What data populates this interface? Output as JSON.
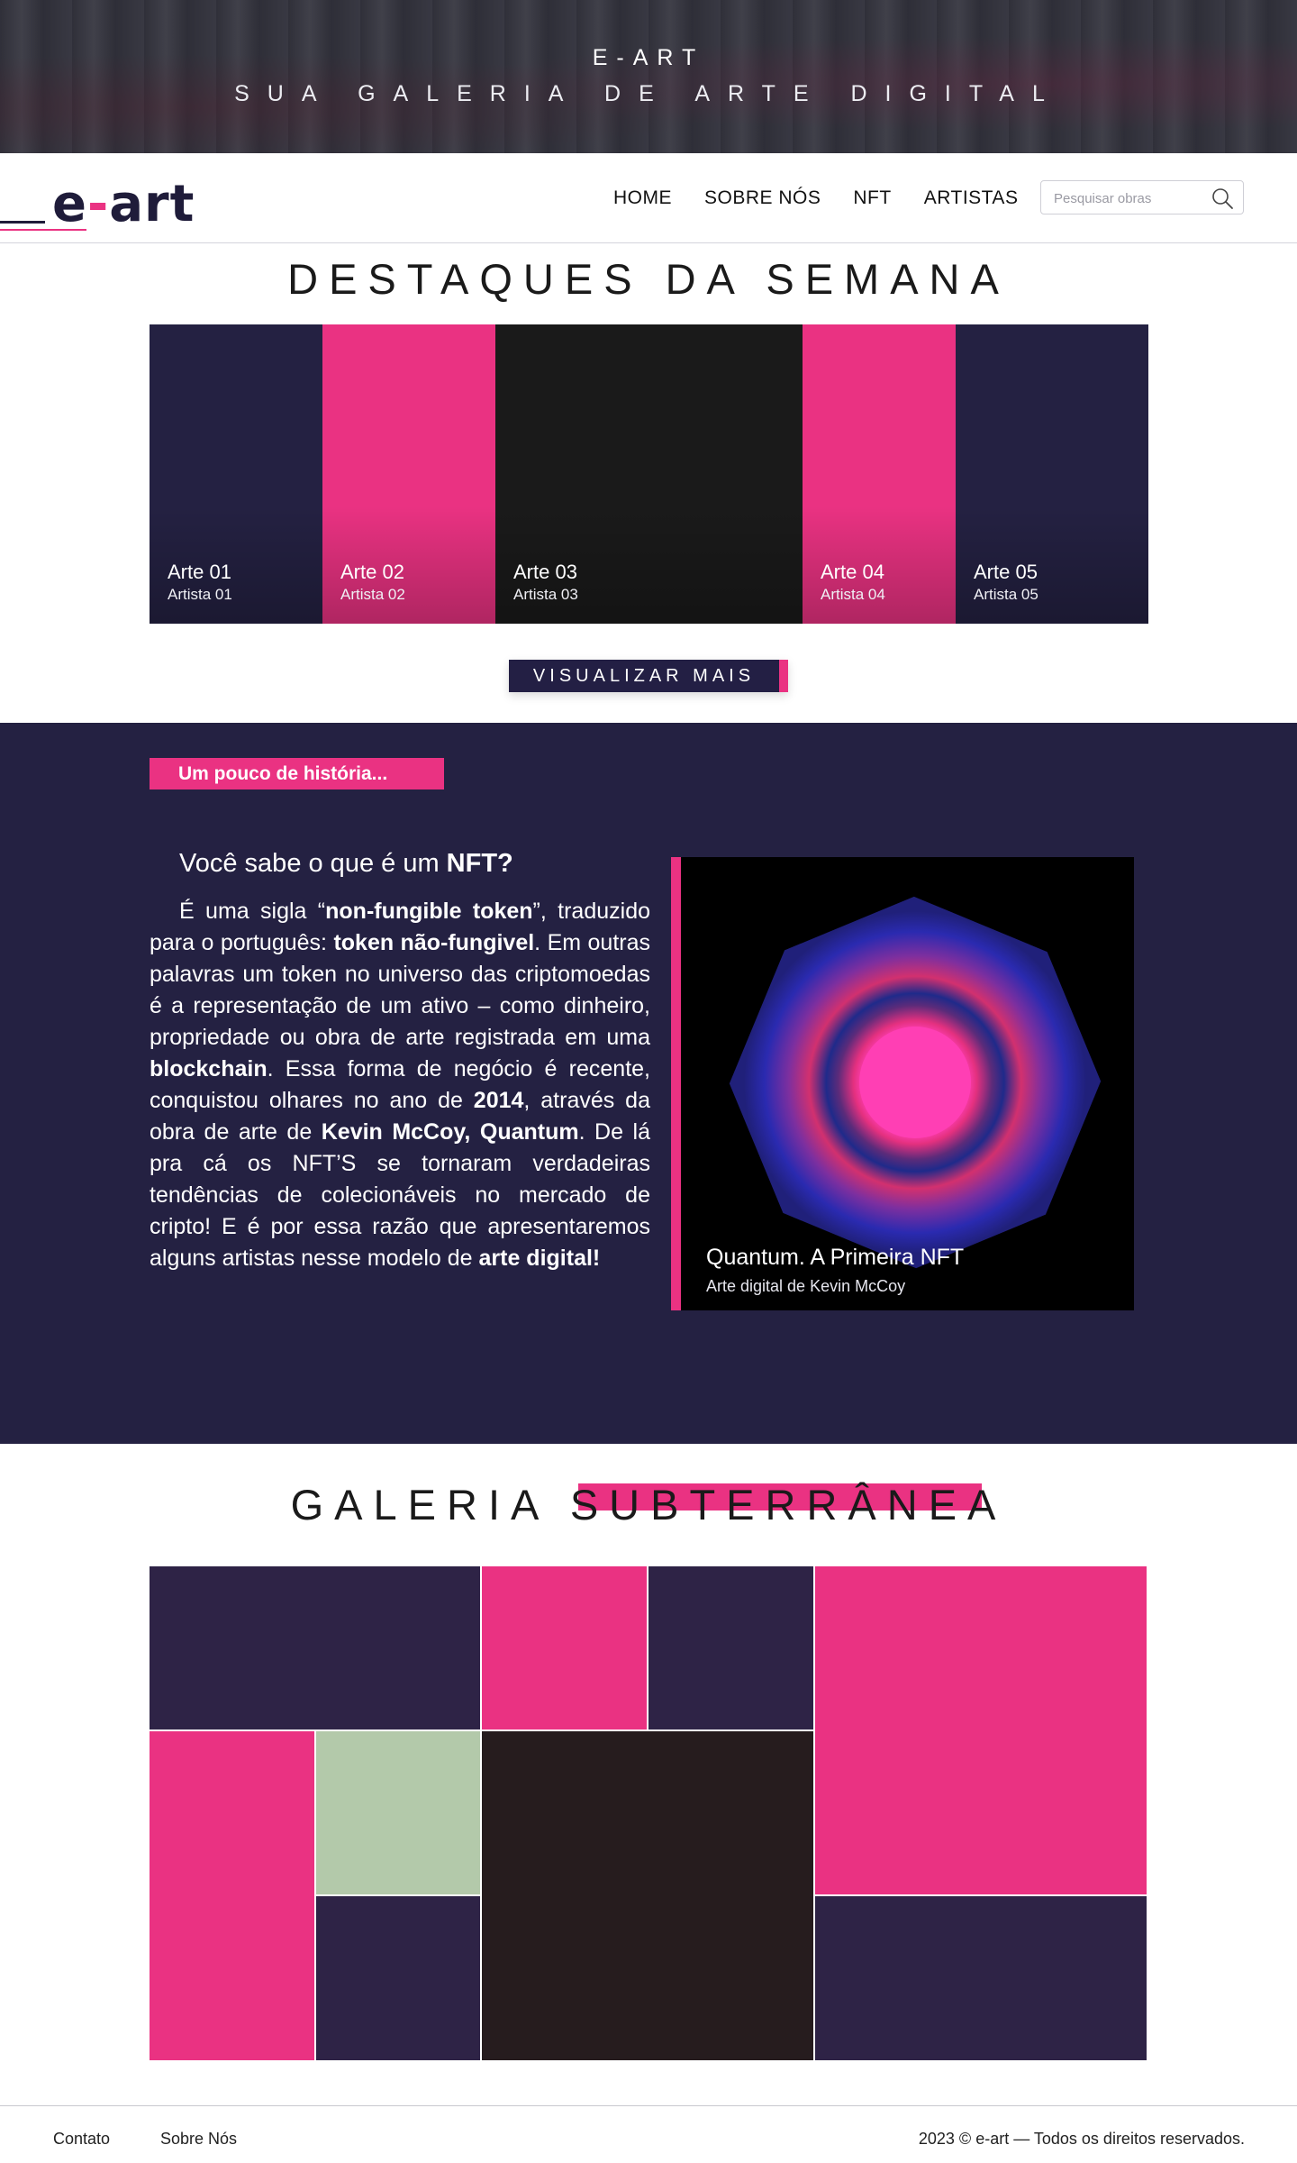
{
  "hero": {
    "title": "E-ART",
    "subtitle": "SUA GALERIA DE ARTE DIGITAL"
  },
  "nav": {
    "logo_text": "e-art",
    "items": [
      "HOME",
      "SOBRE NÓS",
      "NFT",
      "ARTISTAS"
    ],
    "search_placeholder": "Pesquisar obras",
    "search_icon": "search-icon"
  },
  "destaques": {
    "title": "DESTAQUES DA SEMANA",
    "cards": [
      {
        "title": "Arte 01",
        "artist": "Artista 01",
        "color": "#242142"
      },
      {
        "title": "Arte 02",
        "artist": "Artista 02",
        "color": "#ea3282"
      },
      {
        "title": "Arte 03",
        "artist": "Artista 03",
        "color": "#1a1a1a"
      },
      {
        "title": "Arte 04",
        "artist": "Artista 04",
        "color": "#ea3282"
      },
      {
        "title": "Arte 05",
        "artist": "Artista 05",
        "color": "#242142"
      }
    ],
    "view_more": "VISUALIZAR MAIS"
  },
  "historia": {
    "tag": "Um pouco de história...",
    "question_prefix": "Você sabe o que é um ",
    "question_bold": "NFT?",
    "paragraph": [
      {
        "t": "É uma sigla “",
        "b": false
      },
      {
        "t": "non-fungible token",
        "b": true
      },
      {
        "t": "”, traduzido para o português: ",
        "b": false
      },
      {
        "t": "token não-fungivel",
        "b": true
      },
      {
        "t": ". Em outras palavras um token no universo das criptomoedas é a representação de um ativo – como dinheiro, propriedade ou obra de arte registrada em uma ",
        "b": false
      },
      {
        "t": "blockchain",
        "b": true
      },
      {
        "t": ". Essa forma de negócio é recente, conquistou olhares no ano de ",
        "b": false
      },
      {
        "t": "2014",
        "b": true
      },
      {
        "t": ", através da obra de arte de ",
        "b": false
      },
      {
        "t": "Kevin McCoy, Quantum",
        "b": true
      },
      {
        "t": ". De lá pra cá os NFT’S se tornaram verdadeiras tendências de colecionáveis no mercado de cripto! E é por essa razão que apresentaremos alguns artistas nesse modelo de ",
        "b": false
      },
      {
        "t": "arte digital!",
        "b": true
      }
    ],
    "image_title": "Quantum. A Primeira NFT",
    "image_caption": "Arte digital de Kevin McCoy"
  },
  "galeria": {
    "title": "GALERIA SUBTERRÂNEA",
    "tile_colors": [
      "#2e2346",
      "#ea3282",
      "#2e2346",
      "#ea3282",
      "#ea3282",
      "#b3c9aa",
      "#261c1e",
      "#2e2346",
      "#2e2346"
    ]
  },
  "footer": {
    "links": [
      "Contato",
      "Sobre Nós"
    ],
    "copyright": "2023 © e-art — Todos os direitos reservados."
  },
  "colors": {
    "accent": "#ea3282",
    "navy": "#242142"
  }
}
